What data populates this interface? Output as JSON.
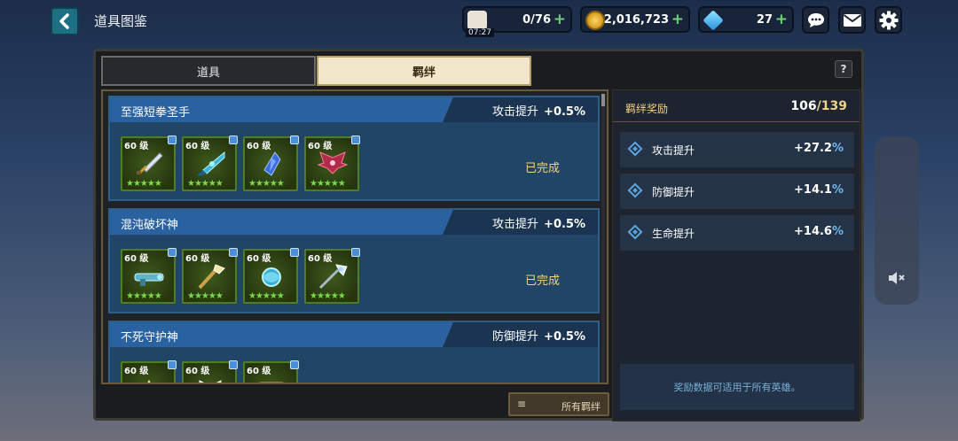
{
  "header": {
    "title": "道具图鉴",
    "stamina": {
      "value": "0/76",
      "timer": "07:27"
    },
    "gold": {
      "value": "2,016,723"
    },
    "gems": {
      "value": "27"
    }
  },
  "tabs": [
    {
      "label": "道具",
      "active": false
    },
    {
      "label": "羁绊",
      "active": true
    }
  ],
  "help_label": "?",
  "bonds": [
    {
      "name": "至强短拳圣手",
      "bonus_label": "攻击提升",
      "bonus_value": "+0.5%",
      "status": "已完成",
      "items": [
        {
          "level": "60 级",
          "stars": "★★★★★",
          "art": "sword"
        },
        {
          "level": "60 级",
          "stars": "★★★★★",
          "art": "blade"
        },
        {
          "level": "60 级",
          "stars": "★★★★★",
          "art": "gem"
        },
        {
          "level": "60 级",
          "stars": "★★★★★",
          "art": "wings"
        }
      ]
    },
    {
      "name": "混沌破坏神",
      "bonus_label": "攻击提升",
      "bonus_value": "+0.5%",
      "status": "已完成",
      "items": [
        {
          "level": "60 级",
          "stars": "★★★★★",
          "art": "gun"
        },
        {
          "level": "60 级",
          "stars": "★★★★★",
          "art": "staff"
        },
        {
          "level": "60 级",
          "stars": "★★★★★",
          "art": "orb"
        },
        {
          "level": "60 级",
          "stars": "★★★★★",
          "art": "rod"
        }
      ]
    },
    {
      "name": "不死守护神",
      "bonus_label": "防御提升",
      "bonus_value": "+0.5%",
      "status": "",
      "items": [
        {
          "level": "60 级",
          "stars": "★★★★★",
          "art": "crown"
        },
        {
          "level": "60 级",
          "stars": "★★★★★",
          "art": "armor"
        },
        {
          "level": "60 级",
          "stars": "★★★★★",
          "art": "chest"
        }
      ]
    }
  ],
  "all_bonds_button": "所有羁绊",
  "rewards": {
    "title": "羁绊奖励",
    "count": "106",
    "total": "/139",
    "stats": [
      {
        "name": "攻击提升",
        "value": "+27.2",
        "unit": "%"
      },
      {
        "name": "防御提升",
        "value": "+14.1",
        "unit": "%"
      },
      {
        "name": "生命提升",
        "value": "+14.6",
        "unit": "%"
      }
    ],
    "note": "奖励数据可适用于所有英雄。"
  },
  "colors": {
    "accent_gold": "#f0d186",
    "star_green": "#7ad94a",
    "stat_blue": "#6fb7ee"
  }
}
